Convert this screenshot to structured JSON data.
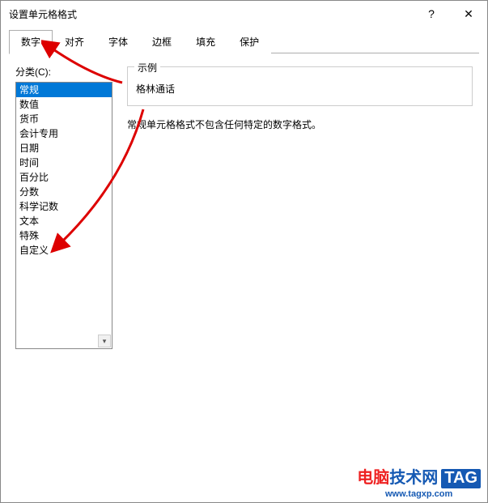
{
  "window": {
    "title": "设置单元格格式"
  },
  "titlebar": {
    "help": "?",
    "close": "✕"
  },
  "tabs": [
    {
      "label": "数字"
    },
    {
      "label": "对齐"
    },
    {
      "label": "字体"
    },
    {
      "label": "边框"
    },
    {
      "label": "填充"
    },
    {
      "label": "保护"
    }
  ],
  "category": {
    "label": "分类(C):",
    "items": [
      "常规",
      "数值",
      "货币",
      "会计专用",
      "日期",
      "时间",
      "百分比",
      "分数",
      "科学记数",
      "文本",
      "特殊",
      "自定义"
    ]
  },
  "sample": {
    "title": "示例",
    "value": "格林通话"
  },
  "description": "常规单元格格式不包含任何特定的数字格式。",
  "scroll_down_glyph": "▾",
  "watermark": {
    "part1": "电脑",
    "part2": "技术网",
    "tag": "TAG",
    "url": "www.tagxp.com"
  }
}
